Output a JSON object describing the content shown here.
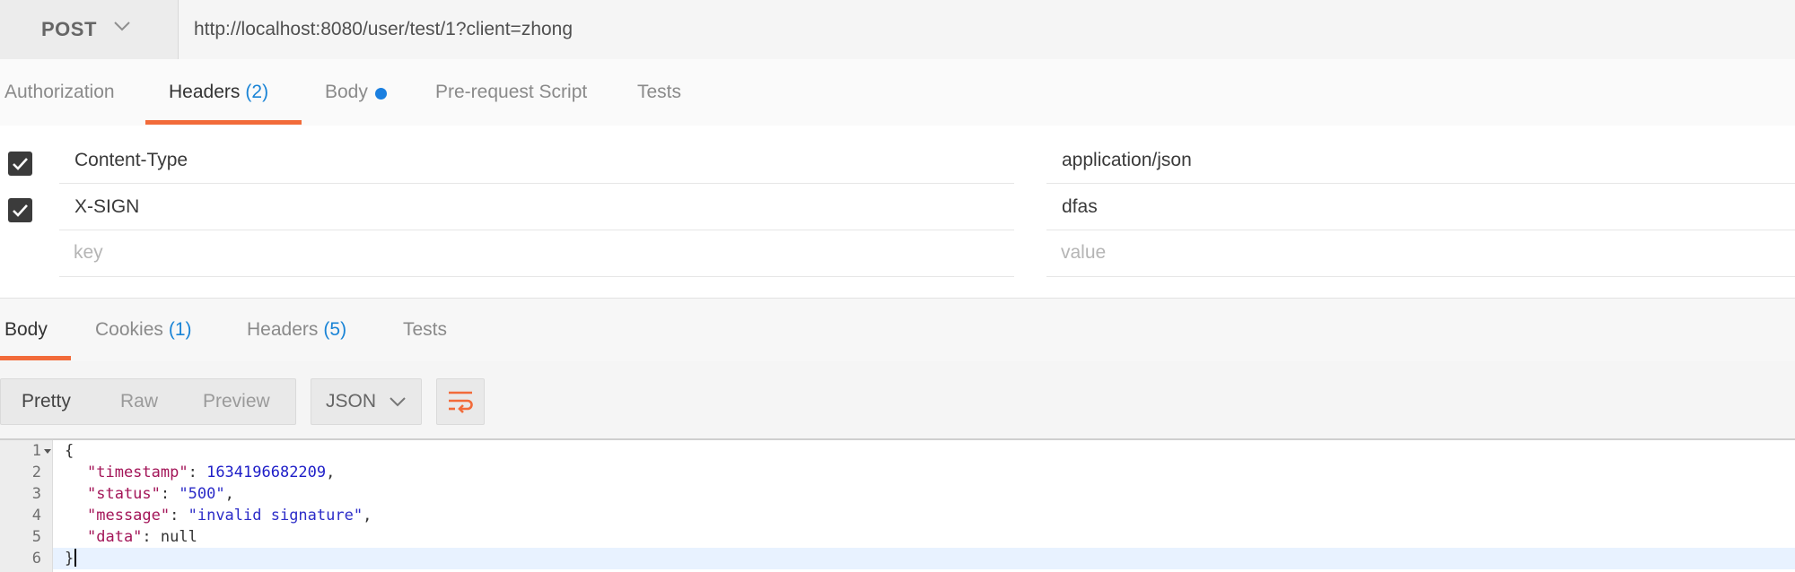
{
  "request": {
    "method": "POST",
    "url": "http://localhost:8080/user/test/1?client=zhong"
  },
  "request_tabs": [
    {
      "label": "Authorization",
      "count": "",
      "active": false
    },
    {
      "label": "Headers",
      "count": "(2)",
      "active": true
    },
    {
      "label": "Body",
      "count": "",
      "active": false,
      "modified_dot": true
    },
    {
      "label": "Pre-request Script",
      "count": "",
      "active": false
    },
    {
      "label": "Tests",
      "count": "",
      "active": false
    }
  ],
  "headers": {
    "rows": [
      {
        "checked": true,
        "key": "Content-Type",
        "value": "application/json"
      },
      {
        "checked": true,
        "key": "X-SIGN",
        "value": "dfas"
      }
    ],
    "new_row": {
      "key_placeholder": "key",
      "value_placeholder": "value"
    }
  },
  "response_tabs": [
    {
      "label": "Body",
      "count": "",
      "active": true
    },
    {
      "label": "Cookies",
      "count": "(1)",
      "active": false
    },
    {
      "label": "Headers",
      "count": "(5)",
      "active": false
    },
    {
      "label": "Tests",
      "count": "",
      "active": false
    }
  ],
  "format_toolbar": {
    "views": [
      "Pretty",
      "Raw",
      "Preview"
    ],
    "active_view": "Pretty",
    "format": "JSON",
    "wrap_icon": "wrap-lines-icon"
  },
  "response_body": {
    "line_numbers": [
      "1",
      "2",
      "3",
      "4",
      "5",
      "6"
    ],
    "lines": {
      "l1_open": "{",
      "l2_key": "\"timestamp\"",
      "l2_val": "1634196682209",
      "l3_key": "\"status\"",
      "l3_val": "\"500\"",
      "l4_key": "\"message\"",
      "l4_val": "\"invalid signature\"",
      "l5_key": "\"data\"",
      "l5_val": "null",
      "l6_close": "}"
    }
  },
  "colors": {
    "accent": "#f26b3a",
    "count_blue": "#1a84d6",
    "json_key": "#a31558",
    "json_value": "#2c2cc8"
  }
}
